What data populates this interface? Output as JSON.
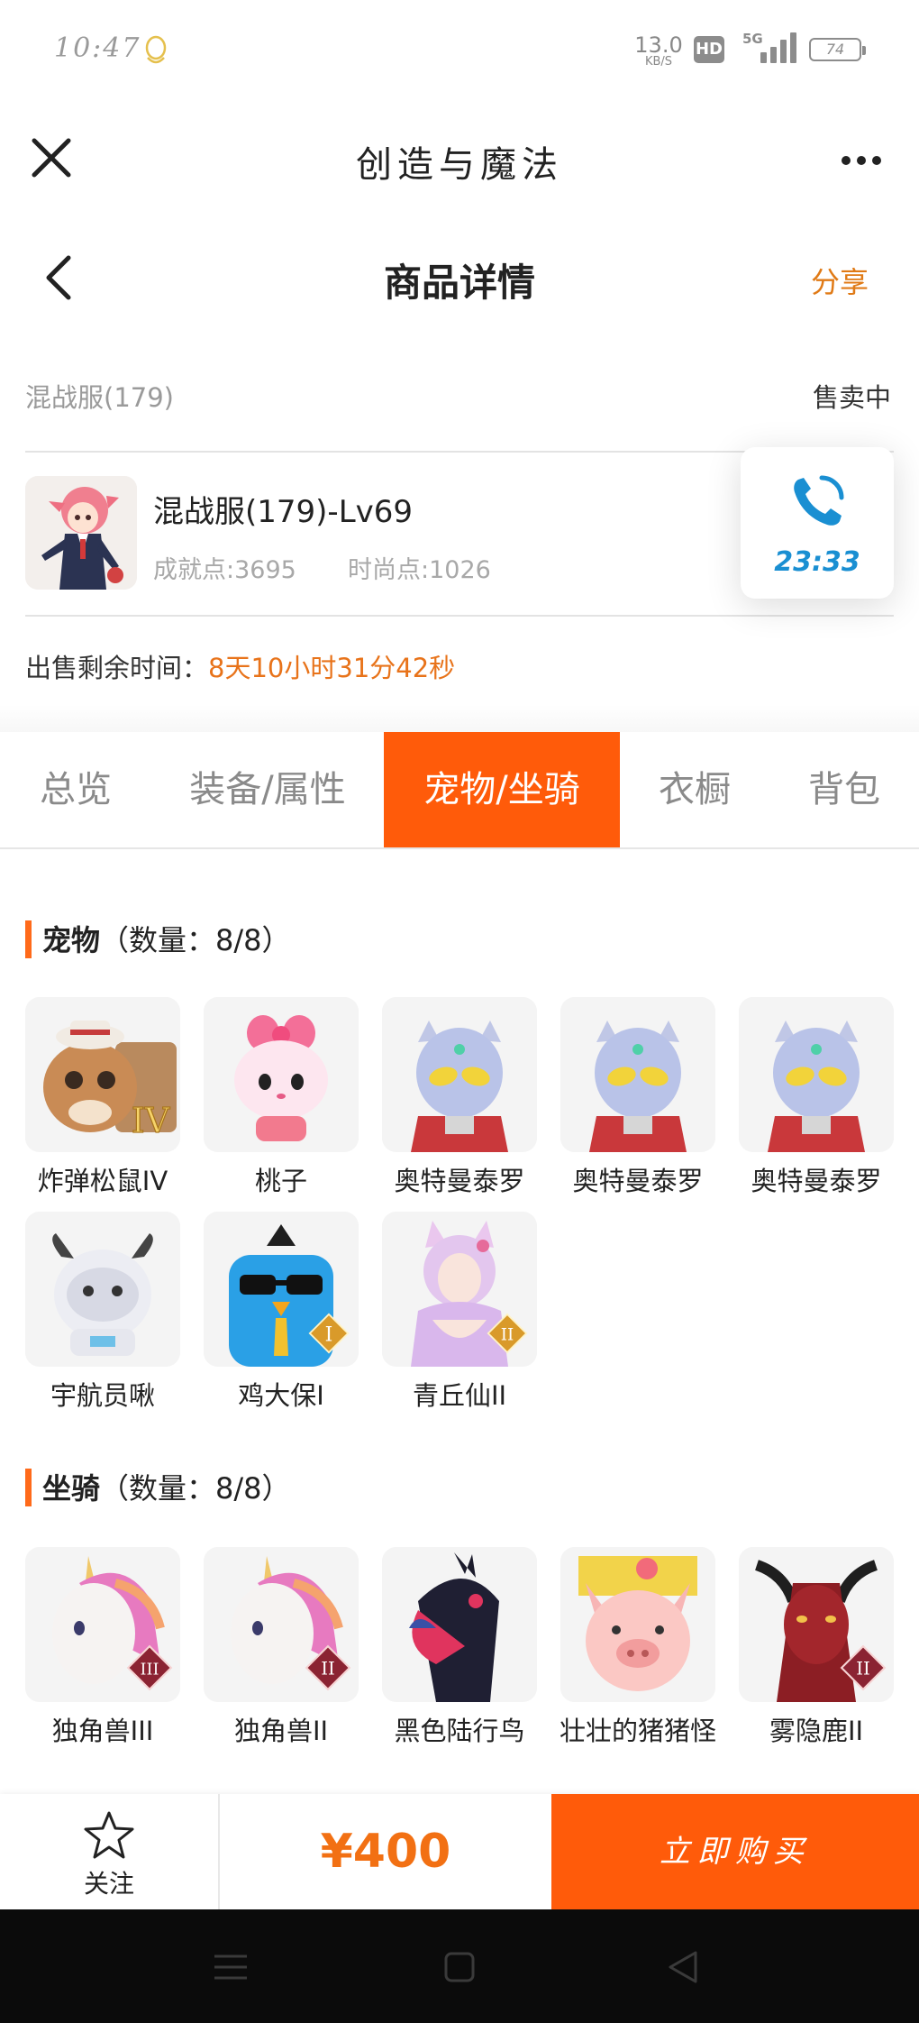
{
  "status": {
    "time": "10:47",
    "net_speed_value": "13.0",
    "net_speed_unit": "KB/S",
    "hd": "HD",
    "network": "5G",
    "battery": "74"
  },
  "titlebar": {
    "app_title": "创造与魔法"
  },
  "nav": {
    "title": "商品详情",
    "share_label": "分享"
  },
  "product": {
    "server": "混战服(179)",
    "status": "售卖中",
    "name": "混战服(179)-Lv69",
    "achievement": "成就点:3695",
    "fashion": "时尚点:1026",
    "remaining_label": "出售剩余时间：",
    "remaining_value": "8天10小时31分42秒"
  },
  "call": {
    "timer": "23:33"
  },
  "tabs": [
    "总览",
    "装备/属性",
    "宠物/坐骑",
    "衣橱",
    "背包"
  ],
  "active_tab": "宠物/坐骑",
  "pets": {
    "title": "宠物",
    "count": "（数量：8/8）",
    "items": [
      {
        "name": "炸弹松鼠IV",
        "tier": "IV"
      },
      {
        "name": "桃子"
      },
      {
        "name": "奥特曼泰罗"
      },
      {
        "name": "奥特曼泰罗"
      },
      {
        "name": "奥特曼泰罗"
      },
      {
        "name": "宇航员啾"
      },
      {
        "name": "鸡大保I",
        "tier": "I"
      },
      {
        "name": "青丘仙II",
        "tier": "II"
      }
    ]
  },
  "mounts": {
    "title": "坐骑",
    "count": "（数量：8/8）",
    "items": [
      {
        "name": "独角兽III",
        "tier": "III"
      },
      {
        "name": "独角兽II",
        "tier": "II"
      },
      {
        "name": "黑色陆行鸟"
      },
      {
        "name": "壮壮的猪猪怪"
      },
      {
        "name": "雾隐鹿II",
        "tier": "II"
      }
    ]
  },
  "bottom": {
    "follow_label": "关注",
    "price": "¥400",
    "buy_label": "立即购买"
  },
  "colors": {
    "accent": "#ff5b0a",
    "highlight": "#e8731a",
    "timer": "#1a8fd2"
  }
}
